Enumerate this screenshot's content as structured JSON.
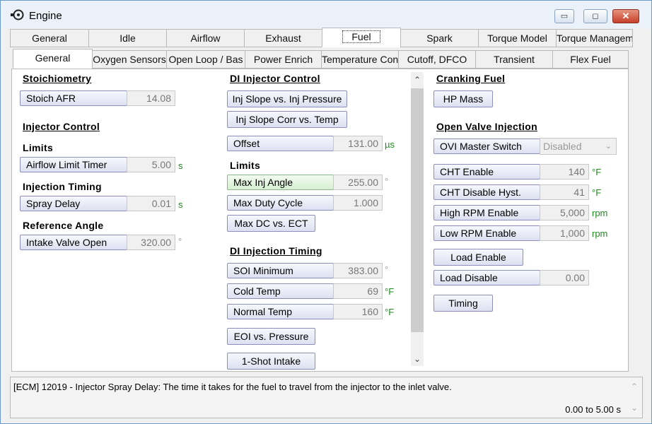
{
  "window": {
    "title": "Engine",
    "minimize": "▭",
    "maximize": "◻",
    "close": "✕"
  },
  "tabs_top": [
    "General",
    "Idle",
    "Airflow",
    "Exhaust",
    "Fuel",
    "Spark",
    "Torque Model",
    "Torque Managem"
  ],
  "tabs_sub": [
    "General",
    "Oxygen Sensors",
    "Open Loop / Bas",
    "Power Enrich",
    "Temperature Cont",
    "Cutoff, DFCO",
    "Transient",
    "Flex Fuel"
  ],
  "col1": {
    "stoich_header": "Stoichiometry",
    "stoich_afr_label": "Stoich AFR",
    "stoich_afr_value": "14.08",
    "injector_control_header": "Injector Control",
    "limits_header": "Limits",
    "airflow_limit_label": "Airflow Limit Timer",
    "airflow_limit_value": "5.00",
    "airflow_limit_unit": "s",
    "injection_timing_header": "Injection Timing",
    "spray_delay_label": "Spray Delay",
    "spray_delay_value": "0.01",
    "spray_delay_unit": "s",
    "reference_angle_header": "Reference Angle",
    "intake_valve_label": "Intake Valve Open",
    "intake_valve_value": "320.00",
    "intake_valve_unit": "°"
  },
  "col2": {
    "di_injector_header": "DI Injector Control",
    "inj_slope_pressure": "Inj Slope vs. Inj Pressure",
    "inj_slope_corr": "Inj Slope Corr vs. Temp",
    "offset_label": "Offset",
    "offset_value": "131.00",
    "offset_unit": "µs",
    "limits_header": "Limits",
    "max_inj_angle_label": "Max Inj Angle",
    "max_inj_angle_value": "255.00",
    "max_inj_angle_unit": "°",
    "max_duty_label": "Max Duty Cycle",
    "max_duty_value": "1.000",
    "max_dc_ect": "Max DC vs. ECT",
    "di_timing_header": "DI Injection Timing",
    "soi_min_label": "SOI Minimum",
    "soi_min_value": "383.00",
    "soi_min_unit": "°",
    "cold_temp_label": "Cold Temp",
    "cold_temp_value": "69",
    "cold_temp_unit": "°F",
    "normal_temp_label": "Normal Temp",
    "normal_temp_value": "160",
    "normal_temp_unit": "°F",
    "eoi_pressure": "EOI vs. Pressure",
    "one_shot_intake": "1-Shot Intake"
  },
  "col3": {
    "cranking_header": "Cranking Fuel",
    "hp_mass": "HP Mass",
    "ovi_header": "Open Valve Injection",
    "ovi_master_label": "OVI Master Switch",
    "ovi_master_value": "Disabled",
    "cht_enable_label": "CHT Enable",
    "cht_enable_value": "140",
    "cht_enable_unit": "°F",
    "cht_disable_label": "CHT Disable Hyst.",
    "cht_disable_value": "41",
    "cht_disable_unit": "°F",
    "high_rpm_label": "High RPM Enable",
    "high_rpm_value": "5,000",
    "high_rpm_unit": "rpm",
    "low_rpm_label": "Low RPM Enable",
    "low_rpm_value": "1,000",
    "low_rpm_unit": "rpm",
    "load_enable": "Load Enable",
    "load_disable_label": "Load Disable",
    "load_disable_value": "0.00",
    "timing": "Timing"
  },
  "status": {
    "text": "[ECM] 12019 - Injector Spray Delay: The time it takes for the fuel to travel from the injector to the inlet valve.",
    "range": "0.00 to 5.00 s"
  }
}
